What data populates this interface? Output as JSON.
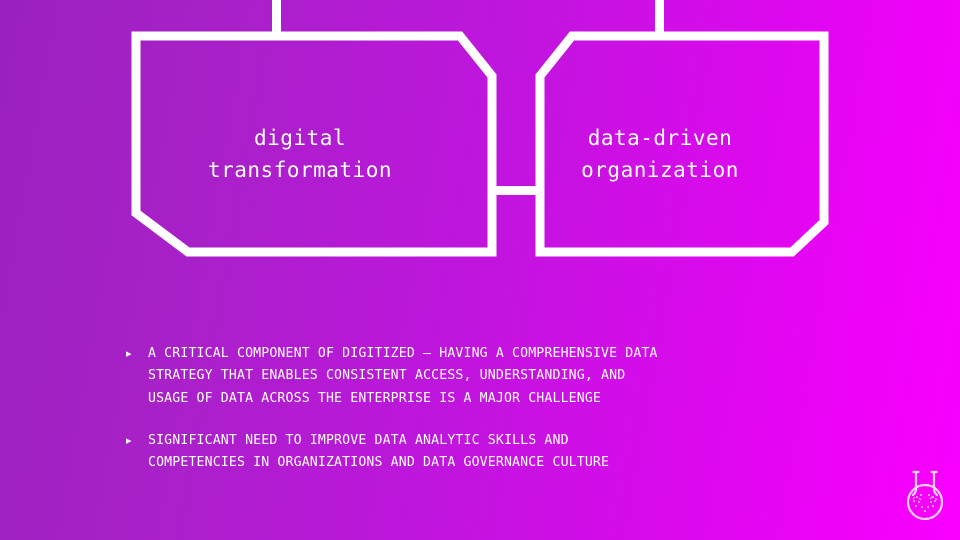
{
  "slide": {
    "background": {
      "gradient_from": "#9A21BD",
      "gradient_to": "#F900FF",
      "direction": "left-to-right"
    },
    "stroke_color": "#FFFFFF",
    "text_color": "#FFFFFF"
  },
  "diagram": {
    "type": "two-chevron-process",
    "shapes": [
      {
        "id": "left-shape",
        "name": "digital-transformation-shape",
        "label": "digital\ntransformation"
      },
      {
        "id": "right-shape",
        "name": "data-driven-organization-shape",
        "label": "data-driven\norganization"
      }
    ],
    "connectors": [
      {
        "id": "connector-top-left",
        "name": "top-stub-left"
      },
      {
        "id": "connector-top-right",
        "name": "top-stub-right"
      },
      {
        "id": "connector-middle",
        "name": "middle-link-bar"
      }
    ]
  },
  "bullets": [
    {
      "marker": "▸",
      "text": "A CRITICAL COMPONENT OF DIGITIZED – HAVING A COMPREHENSIVE DATA\nSTRATEGY THAT ENABLES CONSISTENT ACCESS, UNDERSTANDING, AND\nUSAGE OF DATA ACROSS THE ENTERPRISE IS A MAJOR CHALLENGE"
    },
    {
      "marker": "▸",
      "text": "SIGNIFICANT NEED TO IMPROVE DATA ANALYTIC SKILLS AND\nCOMPETENCIES IN ORGANIZATIONS AND DATA GOVERNANCE CULTURE"
    }
  ],
  "logo": {
    "name": "double-neck-flask-logo",
    "color": "#FFFFFF"
  }
}
